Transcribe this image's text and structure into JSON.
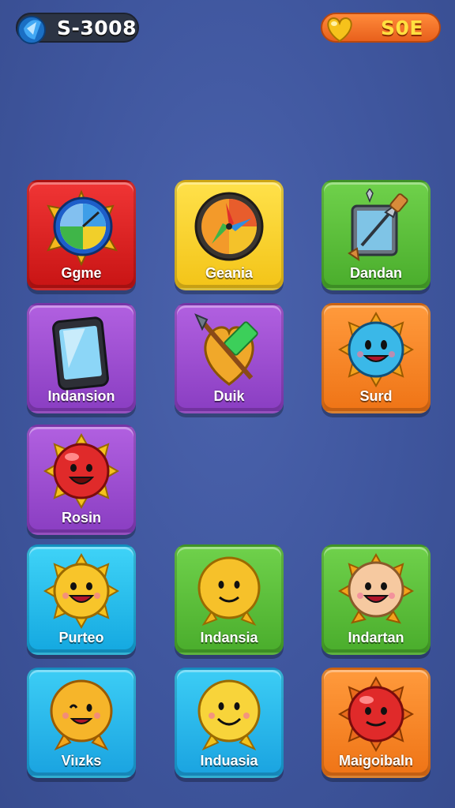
{
  "hud": {
    "left_counter": "S-3008",
    "left_icon": "blue-gem-icon",
    "right_counter": "S0E",
    "right_icon": "gold-heart-icon"
  },
  "tiles": [
    {
      "label": "Ggme",
      "color": "#e02424",
      "icon": "clock-compass-icon"
    },
    {
      "label": "Geania",
      "color": "#f8d531",
      "icon": "compass-dial-icon"
    },
    {
      "label": "Dandan",
      "color": "#5cc23c",
      "icon": "glass-panel-spear-icon"
    },
    {
      "label": "Indansion",
      "color": "#9f4fd6",
      "icon": "phone-icon"
    },
    {
      "label": "Duik",
      "color": "#9f4fd6",
      "icon": "gem-arrow-icon"
    },
    {
      "label": "Surd",
      "color": "#f5862a",
      "icon": "blue-sun-face-icon"
    },
    {
      "label": "Rosin",
      "color": "#9f4fd6",
      "icon": "red-sun-face-icon"
    },
    {
      "label": "Purteo",
      "color": "#29c0ef",
      "icon": "yellow-sun-face-icon"
    },
    {
      "label": "Indansia",
      "color": "#5cc23c",
      "icon": "yellow-blob-face-icon"
    },
    {
      "label": "Indartan",
      "color": "#5cc23c",
      "icon": "peach-sun-face-icon"
    },
    {
      "label": "Viızks",
      "color": "#29c0ef",
      "icon": "orange-blob-face-icon"
    },
    {
      "label": "Induasia",
      "color": "#29c0ef",
      "icon": "yellow-smile-face-icon"
    },
    {
      "label": "Maigoibaln",
      "color": "#f5862a",
      "icon": "red-sun-face-icon"
    }
  ]
}
